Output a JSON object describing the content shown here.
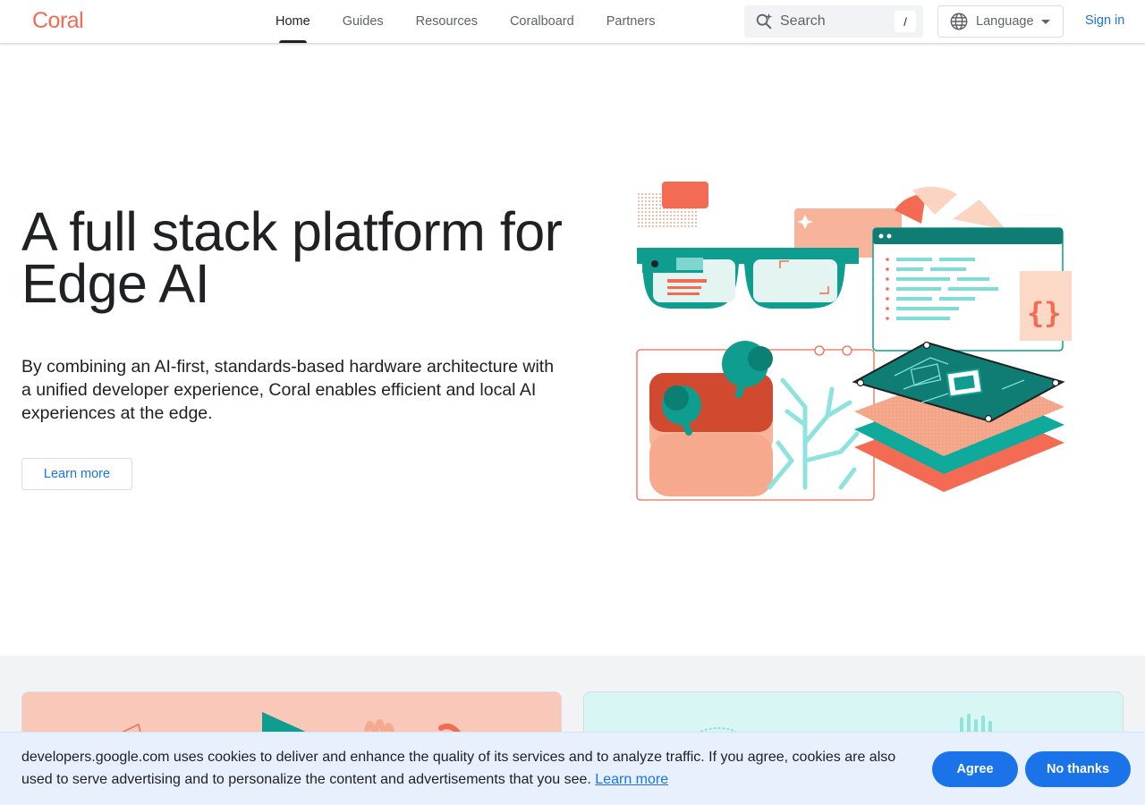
{
  "header": {
    "logo": "Coral",
    "nav": [
      {
        "label": "Home",
        "active": true
      },
      {
        "label": "Guides",
        "active": false
      },
      {
        "label": "Resources",
        "active": false
      },
      {
        "label": "Coralboard",
        "active": false
      },
      {
        "label": "Partners",
        "active": false
      }
    ],
    "search": {
      "placeholder": "Search",
      "shortcut": "/",
      "icon": "search-spark-icon"
    },
    "language": {
      "label": "Language",
      "icon": "globe-icon"
    },
    "signin": "Sign in"
  },
  "hero": {
    "title": "A full stack platform for Edge AI",
    "description": "By combining an AI-first, standards-based hardware architecture with a unified developer experience, Coral enables efficient and local AI experiences at the edge.",
    "cta": "Learn more"
  },
  "cookie": {
    "text": "developers.google.com uses cookies to deliver and enhance the quality of its services and to analyze traffic. If you agree, cookies are also used to serve advertising and to personalize the content and advertisements that you see.",
    "link": "Learn more",
    "agree": "Agree",
    "decline": "No thanks"
  },
  "colors": {
    "brand": "#f26b52",
    "accent": "#1a73e8",
    "teal": "#0f9d8f",
    "peach": "#f9c8b8"
  }
}
